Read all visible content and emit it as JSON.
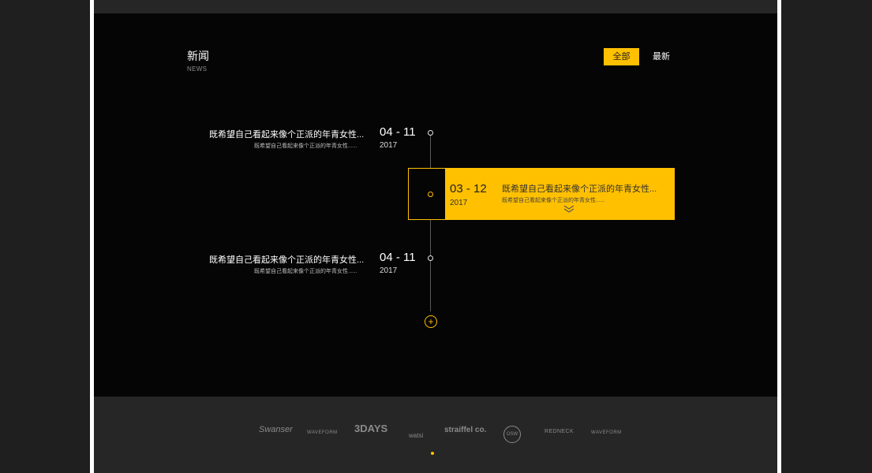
{
  "header": {
    "title": "新闻",
    "subtitle": "NEWS",
    "filters": [
      "全部",
      "最新"
    ]
  },
  "timeline": {
    "items": [
      {
        "title": "既希望自己看起来像个正派的年青女性...",
        "desc": "既希望自己看起来像个正派的年青女性......",
        "date": "04 - 11",
        "year": "2017"
      },
      {
        "title": "既希望自己看起来像个正派的年青女性...",
        "desc": "既希望自己看起来像个正派的年青女性......",
        "date": "03 - 12",
        "year": "2017",
        "active": true
      },
      {
        "title": "既希望自己看起来像个正派的年青女性...",
        "desc": "既希望自己看起来像个正派的年青女性......",
        "date": "04 - 11",
        "year": "2017"
      }
    ],
    "more_icon": "plus-icon"
  },
  "partners": [
    "Swanser",
    "WAVEFORM",
    "3DAYS",
    "watsi",
    "straiffel co.",
    "OSW",
    "REDNECK",
    "WAVEFORM"
  ],
  "colors": {
    "accent": "#ffc000",
    "background": "#050505",
    "footer": "#262626"
  }
}
